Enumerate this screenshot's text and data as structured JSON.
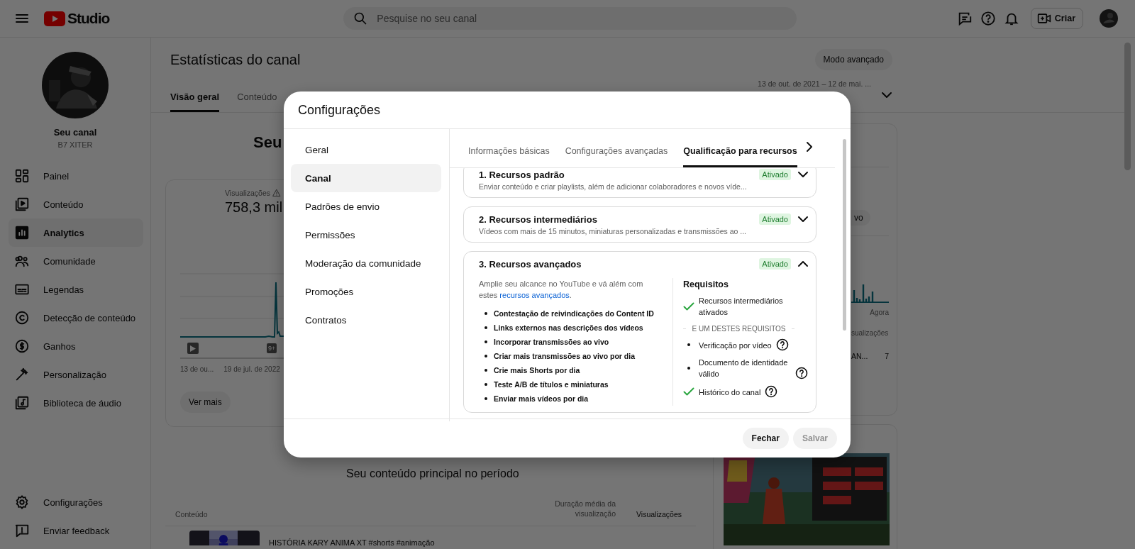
{
  "header": {
    "logo_text": "Studio",
    "search_placeholder": "Pesquise no seu canal",
    "create_label": "Criar"
  },
  "sidebar": {
    "channel_title": "Seu canal",
    "channel_handle": "B7 XITER",
    "items": [
      {
        "label": "Painel",
        "selected": false
      },
      {
        "label": "Conteúdo",
        "selected": false
      },
      {
        "label": "Analytics",
        "selected": true
      },
      {
        "label": "Comunidade",
        "selected": false
      },
      {
        "label": "Legendas",
        "selected": false
      },
      {
        "label": "Detecção de conteúdo",
        "selected": false
      },
      {
        "label": "Ganhos",
        "selected": false
      },
      {
        "label": "Personalização",
        "selected": false
      },
      {
        "label": "Biblioteca de áudio",
        "selected": false
      }
    ],
    "footer_items": [
      {
        "label": "Configurações"
      },
      {
        "label": "Enviar feedback"
      }
    ]
  },
  "analytics": {
    "title": "Estatísticas do canal",
    "advanced_button": "Modo avançado",
    "date_range": "13 de out. de 2021 – 12 de mai. ...",
    "tabs": [
      {
        "label": "Visão geral",
        "selected": true
      },
      {
        "label": "Conteúdo",
        "selected": false
      }
    ],
    "heading": "Seu",
    "views": {
      "label": "Visualizações",
      "value": "758,3 mil",
      "marker_badge": "9+",
      "x_labels": [
        "13 de ou...",
        "19 de jul. de 2022"
      ],
      "more_button": "Ver mais"
    },
    "top_content": {
      "title": "Seu conteúdo principal no período",
      "columns": [
        "Conteúdo",
        "Duração média da visualização",
        "Visualizações"
      ],
      "rows": [
        {
          "title": "HISTÓRIA KARY ANIMA XT #shorts #animação"
        }
      ]
    },
    "side_card": {
      "chip": "vo",
      "axis_label": "Agora",
      "column": "sualizações",
      "row_title": "AN...",
      "row_value": "7"
    }
  },
  "dialog": {
    "title": "Configurações",
    "nav": [
      {
        "label": "Geral",
        "selected": false
      },
      {
        "label": "Canal",
        "selected": true
      },
      {
        "label": "Padrões de envio",
        "selected": false
      },
      {
        "label": "Permissões",
        "selected": false
      },
      {
        "label": "Moderação da comunidade",
        "selected": false
      },
      {
        "label": "Promoções",
        "selected": false
      },
      {
        "label": "Contratos",
        "selected": false
      }
    ],
    "tabs": [
      {
        "label": "Informações básicas",
        "selected": false
      },
      {
        "label": "Configurações avançadas",
        "selected": false
      },
      {
        "label": "Qualificação para recursos",
        "selected": true
      }
    ],
    "levels": [
      {
        "title": "1. Recursos padrão",
        "description": "Enviar conteúdo e criar playlists, além de adicionar colaboradores e novos víde...",
        "status": "Ativado",
        "expanded": false
      },
      {
        "title": "2. Recursos intermediários",
        "description": "Vídeos com mais de 15 minutos, miniaturas personalizadas e transmissões ao ...",
        "status": "Ativado",
        "expanded": false
      },
      {
        "title": "3. Recursos avançados",
        "status": "Ativado",
        "expanded": true,
        "intro": "Amplie seu alcance no YouTube e vá além com estes ",
        "intro_link": "recursos avançados",
        "intro_end": ".",
        "features": [
          "Contestação de reivindicações do Content ID",
          "Links externos nas descrições dos vídeos",
          "Incorporar transmissões ao vivo",
          "Criar mais transmissões ao vivo por dia",
          "Crie mais Shorts por dia",
          "Teste A/B de títulos e miniaturas",
          "Enviar mais vídeos por dia"
        ],
        "requirements_title": "Requisitos",
        "requirements": [
          {
            "label": "Recursos intermediários ativados",
            "met": true,
            "help": false
          }
        ],
        "alternatives_label": "E UM DESTES REQUISITOS",
        "alternatives": [
          {
            "label": "Verificação por vídeo",
            "met": false,
            "help": true
          },
          {
            "label": "Documento de identidade válido",
            "met": false,
            "help": true
          },
          {
            "label": "Histórico do canal",
            "met": true,
            "help": true
          }
        ]
      }
    ],
    "buttons": [
      {
        "label": "Fechar",
        "disabled": false
      },
      {
        "label": "Salvar",
        "disabled": true
      }
    ]
  }
}
